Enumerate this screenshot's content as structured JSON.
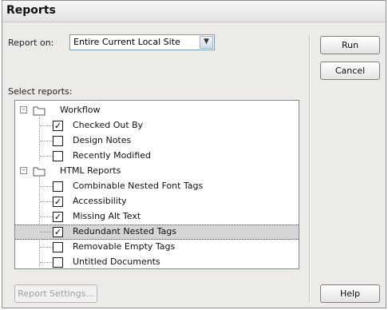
{
  "dialog": {
    "title": "Reports",
    "report_on_label": "Report on:",
    "report_on_value": "Entire Current Local Site",
    "select_reports_label": "Select reports:"
  },
  "buttons": {
    "run": "Run",
    "cancel": "Cancel",
    "help": "Help",
    "report_settings": "Report Settings..."
  },
  "tree": {
    "groups": [
      {
        "label": "Workflow",
        "expander": "minus",
        "items": [
          {
            "label": "Checked Out By",
            "checked": true
          },
          {
            "label": "Design Notes",
            "checked": false
          },
          {
            "label": "Recently Modified",
            "checked": false
          }
        ]
      },
      {
        "label": "HTML Reports",
        "expander": "minus",
        "items": [
          {
            "label": "Combinable Nested Font Tags",
            "checked": false
          },
          {
            "label": "Accessibility",
            "checked": true
          },
          {
            "label": "Missing Alt Text",
            "checked": true
          },
          {
            "label": "Redundant Nested Tags",
            "checked": true,
            "selected": true
          },
          {
            "label": "Removable Empty Tags",
            "checked": false
          },
          {
            "label": "Untitled Documents",
            "checked": false
          }
        ]
      }
    ]
  },
  "icons": {
    "expander": "minus-box-icon",
    "folder": "folder-icon",
    "dropdown": "chevron-down-icon",
    "check": "checkmark-icon"
  }
}
